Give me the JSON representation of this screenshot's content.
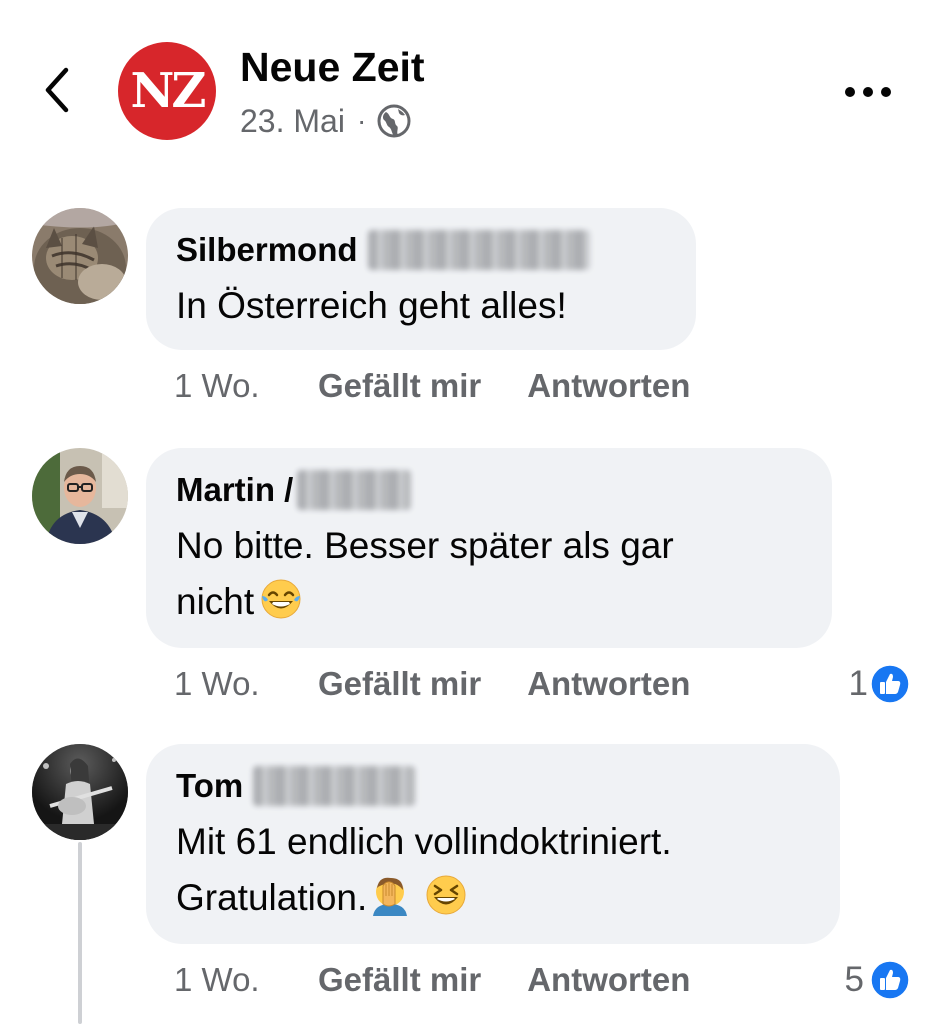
{
  "post": {
    "page_name": "Neue Zeit",
    "page_logo_text": "NZ",
    "date": "23. Mai",
    "separator": "·",
    "audience_icon": "globe-icon",
    "back_icon": "chevron-left-icon",
    "more_icon": "more-horizontal-icon"
  },
  "colors": {
    "brand_red": "#d7262b",
    "bubble_bg": "#f0f2f5",
    "meta_gray": "#65676b",
    "like_blue": "#1877f2"
  },
  "comments": [
    {
      "author": "Silbermond",
      "author_surname_blurred": true,
      "text": "In Österreich geht alles!",
      "time": "1 Wo.",
      "like_label": "Gefällt mir",
      "reply_label": "Antworten",
      "reaction_count": null,
      "emojis": []
    },
    {
      "author": "Martin /",
      "author_surname_blurred": true,
      "text": "No bitte. Besser später als gar\nnicht",
      "time": "1 Wo.",
      "like_label": "Gefällt mir",
      "reply_label": "Antworten",
      "reaction_count": "1",
      "emojis": [
        "tears-of-joy-emoji"
      ]
    },
    {
      "author": "Tom",
      "author_surname_blurred": true,
      "text": "Mit 61 endlich vollindoktriniert.\nGratulation.",
      "time": "1 Wo.",
      "like_label": "Gefällt mir",
      "reply_label": "Antworten",
      "reaction_count": "5",
      "emojis": [
        "facepalm-emoji",
        "grinning-squinting-emoji"
      ]
    }
  ]
}
